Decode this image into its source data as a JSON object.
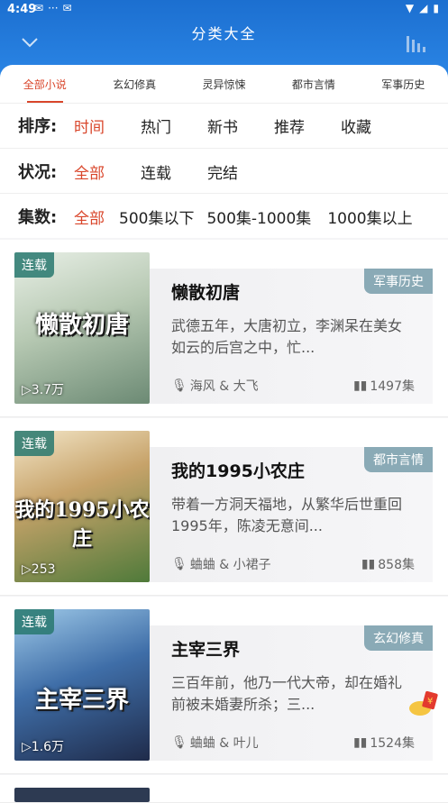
{
  "status": {
    "time": "4:49"
  },
  "header": {
    "title": "分类大全"
  },
  "tabs": [
    "全部小说",
    "玄幻修真",
    "灵异惊悚",
    "都市言情",
    "军事历史"
  ],
  "filters": {
    "sort": {
      "label": "排序:",
      "options": [
        "时间",
        "热门",
        "新书",
        "推荐",
        "收藏"
      ],
      "selected": 0
    },
    "status": {
      "label": "状况:",
      "options": [
        "全部",
        "连载",
        "完结"
      ],
      "selected": 0
    },
    "episodes": {
      "label": "集数:",
      "options": [
        "全部",
        "500集以下",
        "500集-1000集",
        "1000集以上"
      ],
      "selected": 0
    }
  },
  "books": [
    {
      "badge": "连载",
      "cover_text": "懒散初唐",
      "plays": "3.7万",
      "category": "军事历史",
      "title": "懒散初唐",
      "desc": "武德五年，大唐初立，李渊呆在美女如云的后宫之中，忙...",
      "narrators": "海风 & 大飞",
      "episodes": "1497集"
    },
    {
      "badge": "连载",
      "cover_text": "我的1995小农庄",
      "plays": "253",
      "category": "都市言情",
      "title": "我的1995小农庄",
      "desc": "带着一方洞天福地，从繁华后世重回1995年，陈凌无意间...",
      "narrators": "蛐蛐 & 小裙子",
      "episodes": "858集"
    },
    {
      "badge": "连载",
      "cover_text": "主宰三界",
      "plays": "1.6万",
      "category": "玄幻修真",
      "title": "主宰三界",
      "desc": "三百年前，他乃一代大帝，却在婚礼前被未婚妻所杀；三...",
      "narrators": "蛐蛐 & 叶儿",
      "episodes": "1524集"
    }
  ]
}
